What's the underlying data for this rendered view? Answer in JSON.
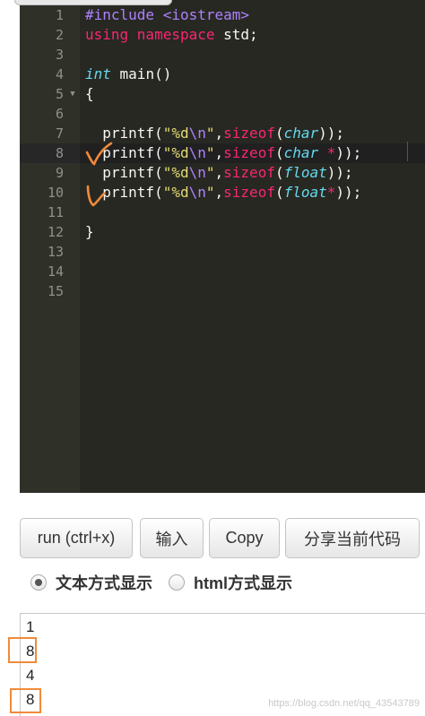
{
  "editor": {
    "lines": [
      {
        "n": "1",
        "tokens": [
          [
            "inc",
            "#include "
          ],
          [
            "inc",
            "<iostream>"
          ]
        ]
      },
      {
        "n": "2",
        "tokens": [
          [
            "kw",
            "using namespace "
          ],
          [
            "plain",
            "std;"
          ]
        ]
      },
      {
        "n": "3",
        "tokens": []
      },
      {
        "n": "4",
        "tokens": [
          [
            "type",
            "int"
          ],
          [
            "plain",
            " main()"
          ]
        ]
      },
      {
        "n": "5",
        "tokens": [
          [
            "plain",
            "{"
          ]
        ],
        "fold": true
      },
      {
        "n": "6",
        "tokens": []
      },
      {
        "n": "7",
        "tokens": [
          [
            "plain",
            "  printf("
          ],
          [
            "str",
            "\"%d"
          ],
          [
            "esc",
            "\\n"
          ],
          [
            "str",
            "\""
          ],
          [
            "plain",
            ","
          ],
          [
            "kw",
            "sizeof"
          ],
          [
            "plain",
            "("
          ],
          [
            "type",
            "char"
          ],
          [
            "plain",
            "));"
          ]
        ]
      },
      {
        "n": "8",
        "tokens": [
          [
            "plain",
            "  printf("
          ],
          [
            "str",
            "\"%d"
          ],
          [
            "esc",
            "\\n"
          ],
          [
            "str",
            "\""
          ],
          [
            "plain",
            ","
          ],
          [
            "kw",
            "sizeof"
          ],
          [
            "plain",
            "("
          ],
          [
            "type",
            "char"
          ],
          [
            "plain",
            " "
          ],
          [
            "op",
            "*"
          ],
          [
            "plain",
            "));"
          ]
        ],
        "active": true
      },
      {
        "n": "9",
        "tokens": [
          [
            "plain",
            "  printf("
          ],
          [
            "str",
            "\"%d"
          ],
          [
            "esc",
            "\\n"
          ],
          [
            "str",
            "\""
          ],
          [
            "plain",
            ","
          ],
          [
            "kw",
            "sizeof"
          ],
          [
            "plain",
            "("
          ],
          [
            "type",
            "float"
          ],
          [
            "plain",
            "));"
          ]
        ]
      },
      {
        "n": "10",
        "tokens": [
          [
            "plain",
            "  printf("
          ],
          [
            "str",
            "\"%d"
          ],
          [
            "esc",
            "\\n"
          ],
          [
            "str",
            "\""
          ],
          [
            "plain",
            ","
          ],
          [
            "kw",
            "sizeof"
          ],
          [
            "plain",
            "("
          ],
          [
            "type",
            "float"
          ],
          [
            "op",
            "*"
          ],
          [
            "plain",
            "));"
          ]
        ]
      },
      {
        "n": "11",
        "tokens": []
      },
      {
        "n": "12",
        "tokens": [
          [
            "plain",
            "}"
          ]
        ]
      },
      {
        "n": "13",
        "tokens": []
      },
      {
        "n": "14",
        "tokens": []
      },
      {
        "n": "15",
        "tokens": []
      }
    ],
    "theme_colors": {
      "background": "#272822",
      "gutter": "#2f3129",
      "annotation": "#f08a3a"
    }
  },
  "buttons": {
    "run": "run (ctrl+x)",
    "input": "输入",
    "copy": "Copy",
    "share": "分享当前代码"
  },
  "output_mode": {
    "text_label": "文本方式显示",
    "html_label": "html方式显示",
    "selected": "text"
  },
  "output": {
    "lines": [
      "1",
      "8",
      "4",
      "8"
    ]
  },
  "watermark": "https://blog.csdn.net/qq_43543789"
}
